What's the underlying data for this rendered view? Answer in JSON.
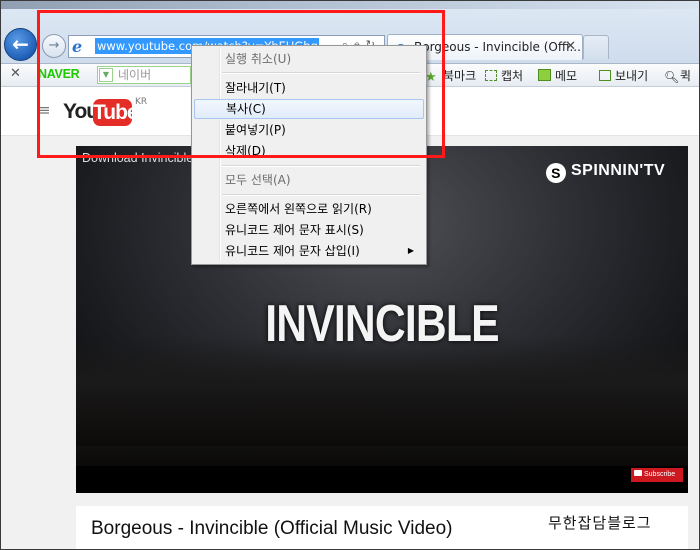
{
  "browser": {
    "url": "www.youtube.com/watch?v=YbEUGhqNTkU",
    "tab_title": "Borgeous - Invincible (Offi...",
    "tab_close": "✕"
  },
  "toolbar": {
    "naver_logo": "NAVER",
    "search_placeholder": "네이버",
    "bookmark": "북마크",
    "capture": "캡처",
    "memo": "메모",
    "send": "보내기",
    "quick": "퀵"
  },
  "page": {
    "logo_you": "You",
    "logo_tube": "Tube",
    "logo_region": "KR",
    "video_overlay_title": "Download Invincible",
    "channel_brand": "SPINNIN'TV",
    "video_text": "INVINCIBLE",
    "subscribe": "Subscribe",
    "video_heading": "Borgeous - Invincible (Official Music Video)",
    "watermark": "무한잡담블로그"
  },
  "context_menu": {
    "items": [
      {
        "label": "실행 취소(U)",
        "disabled": true
      },
      {
        "label": "잘라내기(T)",
        "disabled": false
      },
      {
        "label": "복사(C)",
        "disabled": false,
        "hover": true
      },
      {
        "label": "붙여넣기(P)",
        "disabled": false
      },
      {
        "label": "삭제(D)",
        "disabled": false
      },
      {
        "label": "모두 선택(A)",
        "disabled": true
      },
      {
        "label": "오른쪽에서 왼쪽으로 읽기(R)",
        "disabled": false
      },
      {
        "label": "유니코드 제어 문자 표시(S)",
        "disabled": false
      },
      {
        "label": "유니코드 제어 문자 삽입(I)",
        "disabled": false,
        "submenu": true
      }
    ]
  },
  "colors": {
    "highlight": "#ff1a1a",
    "youtube_red": "#e52d27",
    "url_selection": "#3399ff",
    "naver_green": "#1ec800"
  }
}
